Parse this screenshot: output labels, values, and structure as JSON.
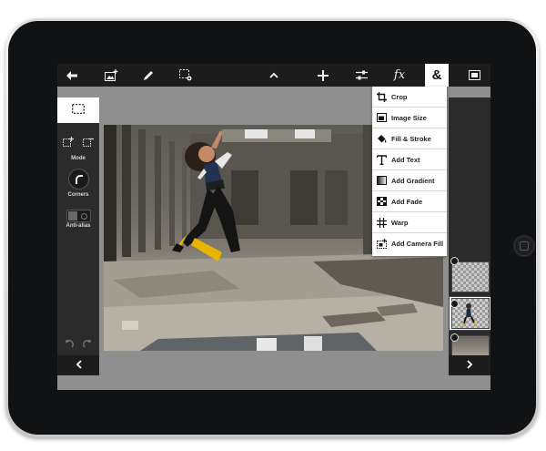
{
  "toolbar": {
    "items": [
      {
        "name": "back",
        "icon": "back-arrow-icon"
      },
      {
        "name": "add-image",
        "icon": "add-image-icon"
      },
      {
        "name": "brush",
        "icon": "pencil-icon"
      },
      {
        "name": "selection-options",
        "icon": "selection-gear-icon"
      },
      {
        "name": "collapse",
        "icon": "chevron-up-icon"
      },
      {
        "name": "move",
        "icon": "move-cross-icon"
      },
      {
        "name": "adjustments",
        "icon": "sliders-icon"
      },
      {
        "name": "effects",
        "icon": "fx-icon",
        "label": "fx"
      },
      {
        "name": "more-tools",
        "icon": "ampersand-icon",
        "label": "&",
        "active": true
      },
      {
        "name": "fullscreen",
        "icon": "fullscreen-icon"
      }
    ]
  },
  "left_panel": {
    "tool": "marquee-icon",
    "mode_label": "Mode",
    "corners_label": "Corners",
    "antialias_label": "Anti-alias"
  },
  "menu": {
    "items": [
      {
        "label": "Crop",
        "icon": "crop-icon"
      },
      {
        "label": "Image Size",
        "icon": "image-size-icon"
      },
      {
        "label": "Fill & Stroke",
        "icon": "bucket-icon"
      },
      {
        "label": "Add Text",
        "icon": "text-icon"
      },
      {
        "label": "Add Gradient",
        "icon": "gradient-icon"
      },
      {
        "label": "Add Fade",
        "icon": "fade-icon"
      },
      {
        "label": "Warp",
        "icon": "warp-grid-icon"
      },
      {
        "label": "Add Camera Fill",
        "icon": "camera-fill-icon"
      }
    ]
  },
  "colors": {
    "toolbar_bg": "#1c1c1c",
    "panel_bg": "#2b2b2b",
    "canvas_bg": "#8f8f8f",
    "bezel": "#111214",
    "menu_bg": "#ffffff"
  }
}
